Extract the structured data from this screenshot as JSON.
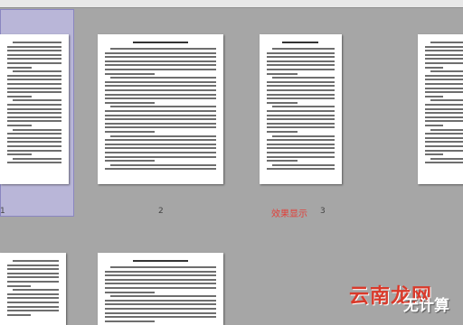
{
  "app": {
    "title": ""
  },
  "thumbnails": [
    {
      "page_number": "1",
      "selected": true
    },
    {
      "page_number": "2",
      "selected": false
    },
    {
      "page_number": "3",
      "selected": false
    },
    {
      "page_number": "",
      "selected": false
    },
    {
      "page_number": "",
      "selected": false
    },
    {
      "page_number": "",
      "selected": false
    }
  ],
  "overlay_text": "效果显示",
  "watermark": {
    "text_main": "云南龙网",
    "text_sub": "无计算"
  },
  "colors": {
    "workspace": "#a6a6a6",
    "selection": "#b9b6d8",
    "overlay_text": "#e0403a",
    "watermark": "#d93a2b"
  }
}
